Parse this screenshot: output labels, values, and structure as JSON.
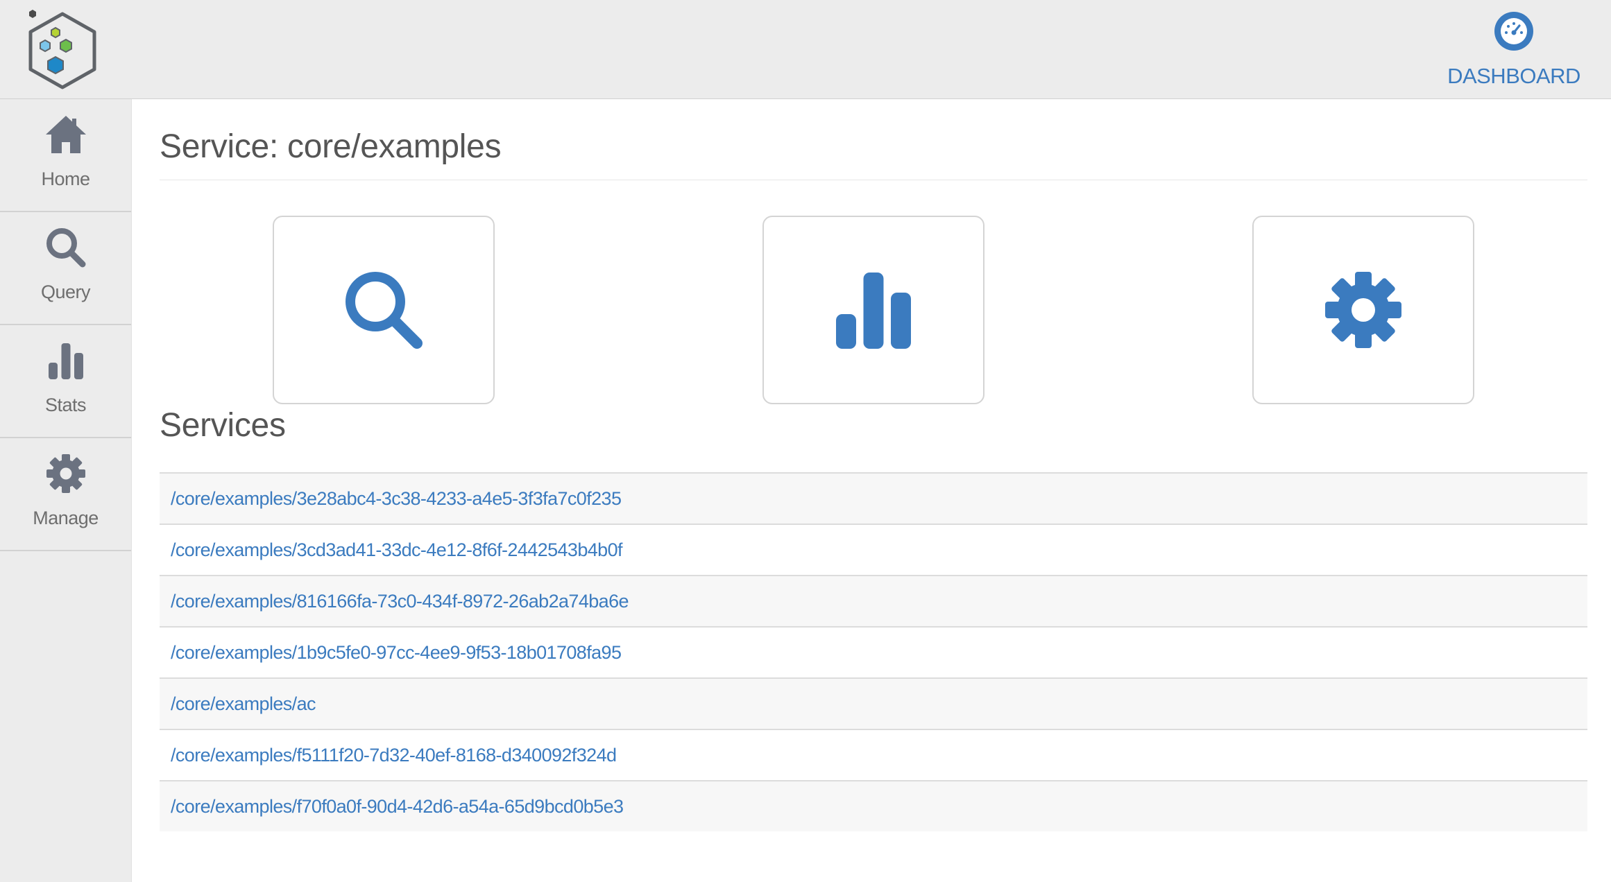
{
  "header": {
    "logo_icon": "hexagon-cluster-logo-icon",
    "dashboard": {
      "label": "DASHBOARD",
      "icon": "gauge-icon"
    }
  },
  "sidebar": {
    "items": [
      {
        "label": "Home",
        "icon": "home-icon"
      },
      {
        "label": "Query",
        "icon": "search-icon"
      },
      {
        "label": "Stats",
        "icon": "bar-chart-icon"
      },
      {
        "label": "Manage",
        "icon": "gear-icon"
      }
    ]
  },
  "main": {
    "title": "Service: core/examples",
    "tiles": [
      {
        "icon": "search-icon"
      },
      {
        "icon": "bar-chart-icon"
      },
      {
        "icon": "gear-icon"
      }
    ],
    "services_heading": "Services",
    "services": [
      "/core/examples/3e28abc4-3c38-4233-a4e5-3f3fa7c0f235",
      "/core/examples/3cd3ad41-33dc-4e12-8f6f-2442543b4b0f",
      "/core/examples/816166fa-73c0-434f-8972-26ab2a74ba6e",
      "/core/examples/1b9c5fe0-97cc-4ee9-9f53-18b01708fa95",
      "/core/examples/ac",
      "/core/examples/f5111f20-7d32-40ef-8168-d340092f324d",
      "/core/examples/f70f0a0f-90d4-42d6-a54a-65d9bcd0b5e3"
    ]
  },
  "colors": {
    "accent": "#3b7bbf",
    "sidebar_icon": "#6b7280",
    "logo_outline": "#5f6368",
    "logo_green": "#6dbf4b",
    "logo_blue": "#1e88c8",
    "logo_light_blue": "#7cc5ea",
    "logo_lime": "#b5d334",
    "header_bg": "#ececec"
  }
}
